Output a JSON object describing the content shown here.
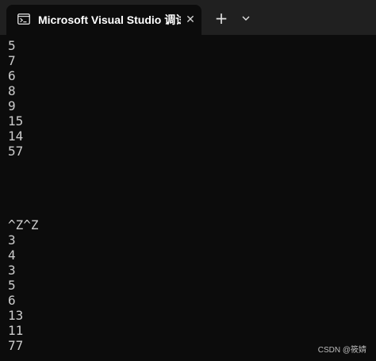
{
  "tab": {
    "icon": "terminal-icon",
    "title": "Microsoft Visual Studio 调试控",
    "close_glyph": "✕"
  },
  "toolbar": {
    "new_tab_glyph": "+",
    "dropdown_icon": "chevron-down-icon"
  },
  "console": {
    "lines": [
      "5",
      "7",
      "6",
      "8",
      "9",
      "15",
      "14",
      "57",
      "",
      "",
      "",
      "",
      "^Z^Z",
      "3",
      "4",
      "3",
      "5",
      "6",
      "13",
      "11",
      "77"
    ]
  },
  "watermark": "CSDN @筱婧"
}
